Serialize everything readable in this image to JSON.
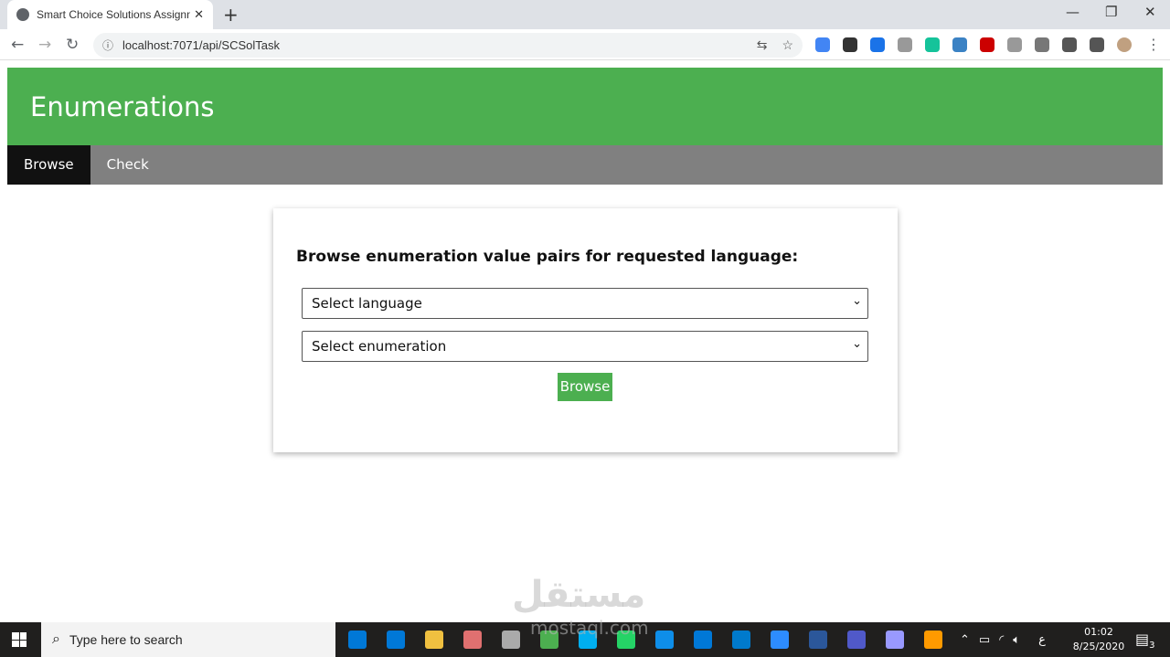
{
  "browser": {
    "tab_title": "Smart Choice Solutions Assignment",
    "url": "localhost:7071/api/SCSolTask",
    "extensions": [
      "google-translate",
      "download",
      "graduation-cap",
      "chain",
      "grammarly-off",
      "edge-circle",
      "adblock-plus",
      "speed-dial",
      "drive",
      "puzzle",
      "media-queue",
      "avatar"
    ],
    "extension_colors": [
      "#4285f4",
      "#333333",
      "#1a73e8",
      "#999999",
      "#15c39a",
      "#3b82c4",
      "#cc0000",
      "#999999",
      "#777777",
      "#555555",
      "#555555",
      "#c0a080"
    ]
  },
  "header": {
    "title": "Enumerations",
    "color": "#4caf50"
  },
  "menu": {
    "items": [
      {
        "label": "Browse",
        "active": true
      },
      {
        "label": "Check",
        "active": false
      }
    ]
  },
  "form": {
    "heading": "Browse enumeration value pairs for requested language:",
    "language_select": "Select language",
    "enumeration_select": "Select enumeration",
    "submit_label": "Browse"
  },
  "watermark": "مستقل mostaql.com",
  "taskbar": {
    "search_placeholder": "Type here to search",
    "apps": [
      "edge",
      "store",
      "file-explorer",
      "paint",
      "scanner",
      "chrome",
      "skype",
      "whatsapp",
      "teamviewer",
      "mail",
      "vscode",
      "zoom",
      "word",
      "teams",
      "after-effects",
      "illustrator"
    ],
    "app_colors": [
      "#0078d7",
      "#0078d7",
      "#f0c040",
      "#e07070",
      "#aaaaaa",
      "#4caf50",
      "#00aff0",
      "#25d366",
      "#0e8ee9",
      "#0078d7",
      "#007acc",
      "#2d8cff",
      "#2b579a",
      "#5059c9",
      "#9999ff",
      "#ff9a00"
    ],
    "time": "01:02",
    "date": "8/25/2020",
    "language": "ع",
    "notifications": "3"
  }
}
